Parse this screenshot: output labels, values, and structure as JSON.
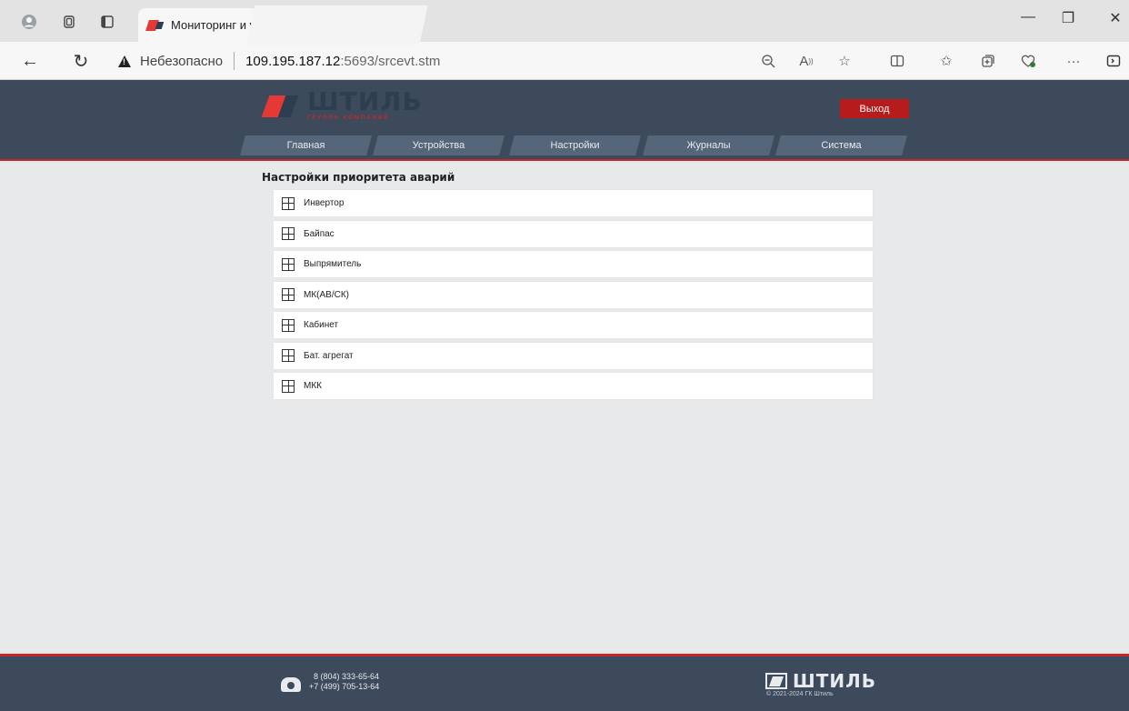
{
  "browser": {
    "tab_title": "Мониторинг и управление сист",
    "security_label": "Небезопасно",
    "url_host": "109.195.187.12",
    "url_rest": ":5693/srcevt.stm"
  },
  "header": {
    "logo_word": "ШТИЛЬ",
    "logo_sub": "ГРУППА КОМПАНИЙ",
    "logout_label": "Выход",
    "menu": [
      {
        "label": "Главная"
      },
      {
        "label": "Устройства"
      },
      {
        "label": "Настройки"
      },
      {
        "label": "Журналы"
      },
      {
        "label": "Система"
      }
    ]
  },
  "main": {
    "title": "Настройки приоритета аварий",
    "items": [
      {
        "label": "Инвертор"
      },
      {
        "label": "Байпас"
      },
      {
        "label": "Выпрямитель"
      },
      {
        "label": "МК(АВ/СК)"
      },
      {
        "label": "Кабинет"
      },
      {
        "label": "Бат. агрегат"
      },
      {
        "label": "МКК"
      }
    ]
  },
  "footer": {
    "phone_1": "8 (804) 333-65-64",
    "phone_2": "+7 (499) 705-13-64",
    "logo_word": "ШТИЛЬ",
    "copyright": "© 2021-2024 ГК Штиль"
  }
}
